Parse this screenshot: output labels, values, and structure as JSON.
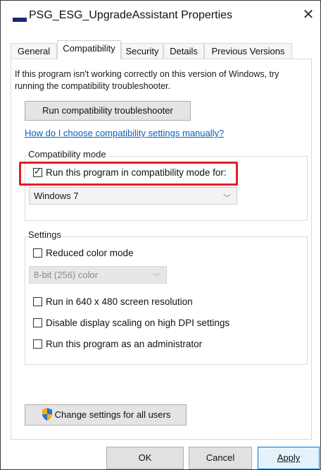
{
  "window": {
    "title": "PSG_ESG_UpgradeAssistant Properties",
    "close_glyph": "✕"
  },
  "tabs": [
    "General",
    "Compatibility",
    "Security",
    "Details",
    "Previous Versions"
  ],
  "active_tab": "Compatibility",
  "intro_text": "If this program isn't working correctly on this version of Windows, try running the compatibility troubleshooter.",
  "troubleshooter_button": "Run compatibility troubleshooter",
  "help_link": "How do I choose compatibility settings manually?",
  "compat_mode": {
    "group_label": "Compatibility mode",
    "checkbox_label": "Run this program in compatibility mode for:",
    "checked": true,
    "selected_os": "Windows 7"
  },
  "settings": {
    "group_label": "Settings",
    "reduced_color": {
      "label": "Reduced color mode",
      "checked": false
    },
    "color_dropdown": "8-bit (256) color",
    "resolution": {
      "label": "Run in 640 x 480 screen resolution",
      "checked": false
    },
    "dpi": {
      "label": "Disable display scaling on high DPI settings",
      "checked": false
    },
    "admin": {
      "label": "Run this program as an administrator",
      "checked": false
    }
  },
  "change_all_button": "Change settings for all users",
  "footer": {
    "ok": "OK",
    "cancel": "Cancel",
    "apply": "Apply"
  },
  "colors": {
    "highlight": "#e41e25",
    "link": "#0a5fbf",
    "title_icon": "#1a2a6e"
  },
  "icons": {
    "shield": "uac-shield-icon",
    "chevron": "chevron-down-icon",
    "check": "checkmark-icon"
  }
}
